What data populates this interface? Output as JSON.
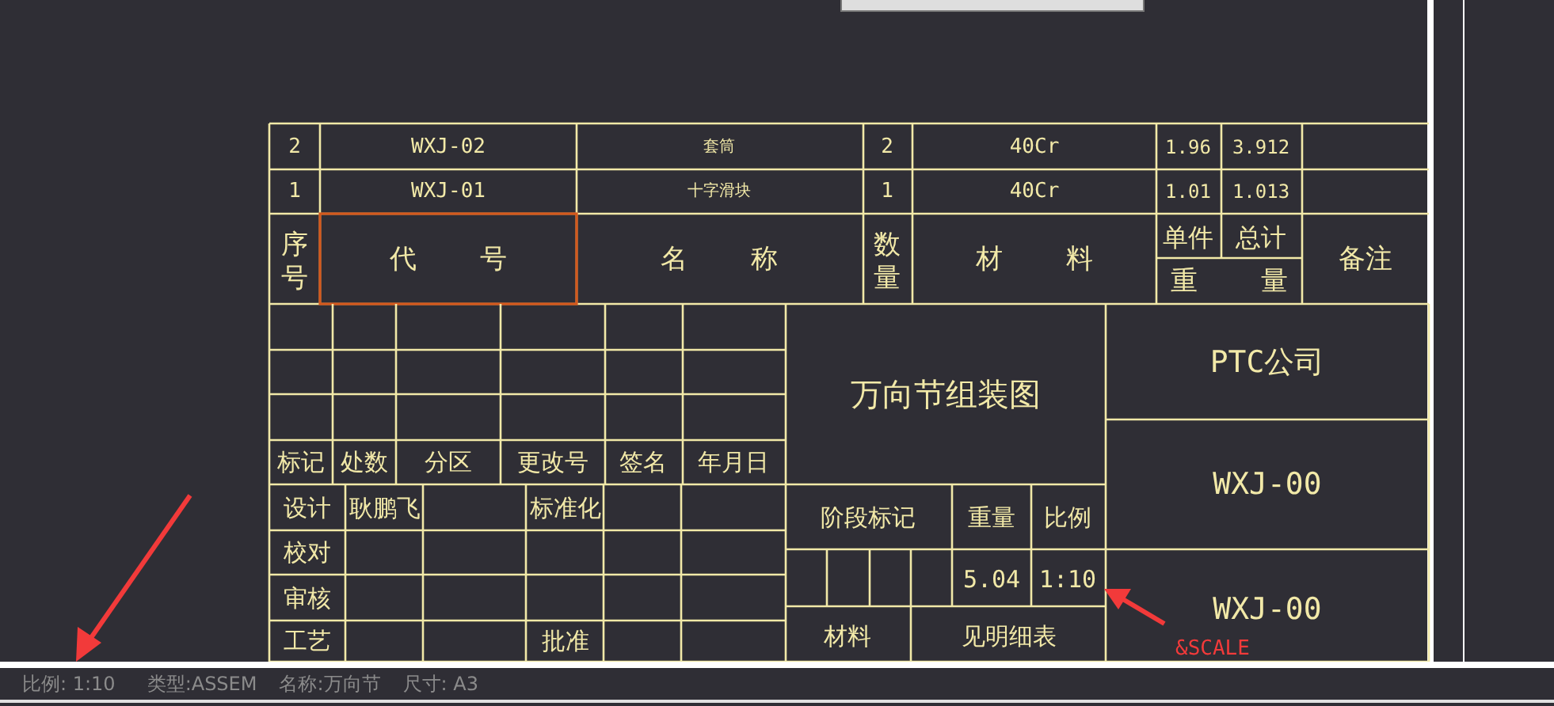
{
  "parts_list": {
    "rows": [
      {
        "index": "2",
        "code": "WXJ-02",
        "name": "套筒",
        "qty": "2",
        "material": "40Cr",
        "unit_weight": "1.96",
        "total_weight": "3.912"
      },
      {
        "index": "1",
        "code": "WXJ-01",
        "name": "十字滑块",
        "qty": "1",
        "material": "40Cr",
        "unit_weight": "1.01",
        "total_weight": "1.013"
      }
    ],
    "header": {
      "index": "序号",
      "code": "代 号",
      "code_selected": true,
      "name": "名 称",
      "qty": "数量",
      "material": "材 料",
      "unit": "单件",
      "total": "总计",
      "weight": "重 量",
      "note": "备注"
    }
  },
  "title_block": {
    "revision_headers": [
      "标记",
      "处数",
      "分区",
      "更改号",
      "签名",
      "年月日"
    ],
    "approvals": [
      {
        "label": "设计",
        "value": "耿鹏飞",
        "extra": "标准化"
      },
      {
        "label": "校对"
      },
      {
        "label": "审核"
      },
      {
        "label": "工艺",
        "extra": "批准"
      }
    ],
    "title": "万向节组装图",
    "stage_label": "阶段标记",
    "weight_label": "重量",
    "scale_label": "比例",
    "weight": "5.04",
    "scale": "1:10",
    "material_label": "材料",
    "material": "见明细表",
    "company": "PTC公司",
    "drawing_number": "WXJ-00",
    "drawing_number_2": "WXJ-00"
  },
  "annotation": "&SCALE",
  "status_bar": [
    "比例: 1:10",
    "类型:ASSEM",
    "名称:万向节",
    "尺寸: A3"
  ]
}
